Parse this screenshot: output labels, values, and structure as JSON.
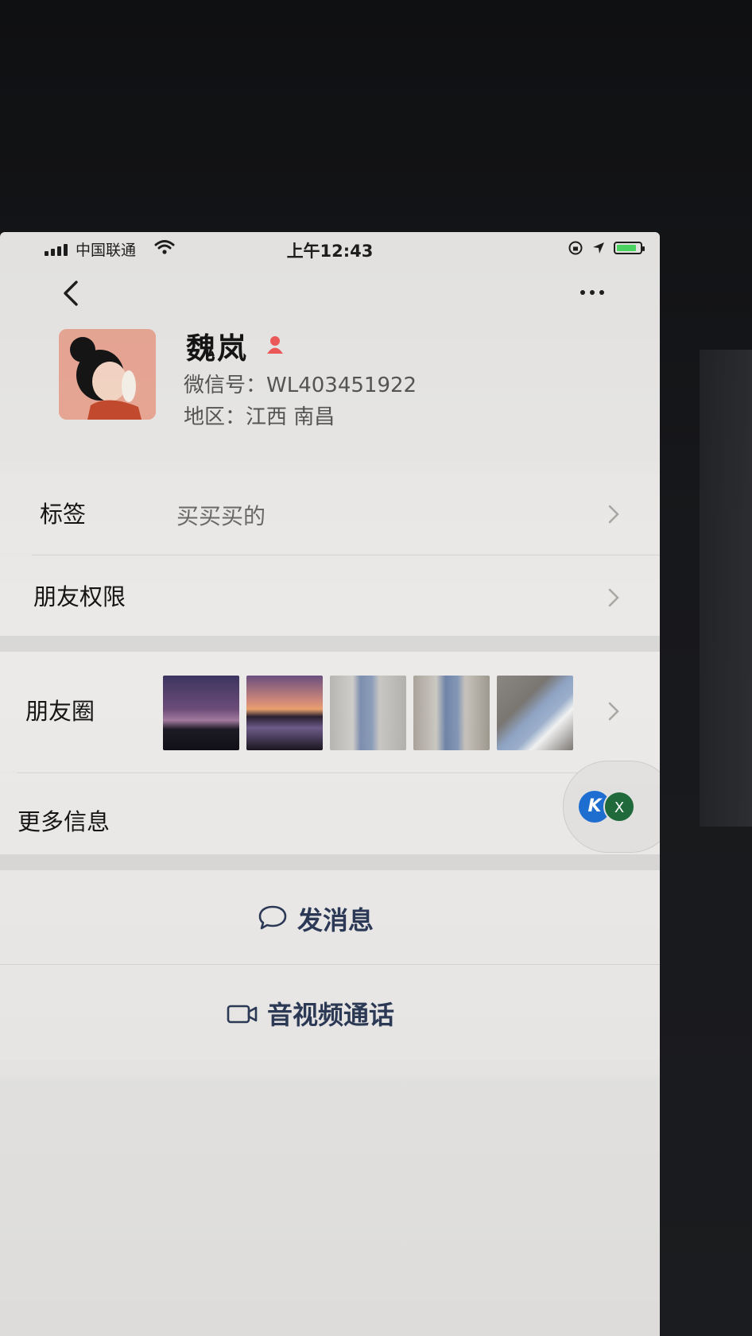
{
  "status_bar": {
    "carrier": "中国联通",
    "time": "上午12:43",
    "battery_level": 0.85
  },
  "nav": {
    "back_icon": "chevron-left-icon",
    "more_icon": "ellipsis-icon"
  },
  "profile": {
    "name": "魏岚",
    "wechat_id": "微信号：WL403451922",
    "region": "地区：江西 南昌",
    "gender_icon": "female-icon"
  },
  "rows": {
    "tags": {
      "label": "标签",
      "value": "买买买的"
    },
    "permissions": {
      "label": "朋友权限"
    },
    "moments": {
      "label": "朋友圈"
    },
    "more_info": {
      "label": "更多信息"
    }
  },
  "actions": {
    "send_message": "发消息",
    "video_call": "音视频通话"
  },
  "floating": {
    "k_label": "K",
    "x_label": "X"
  },
  "colors": {
    "accent_text": "#2c3a57",
    "background": "#eceae8",
    "female_icon": "#f05a5a"
  }
}
